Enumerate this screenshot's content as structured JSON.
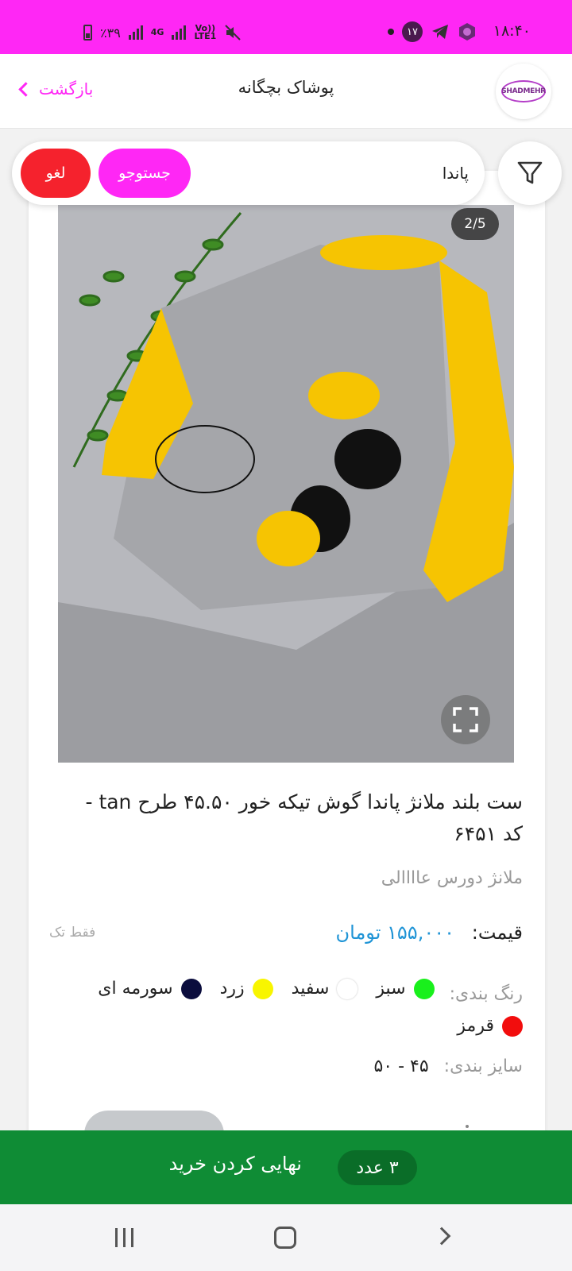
{
  "status_bar": {
    "time": "۱۸:۴۰",
    "notification_count": "۱۷",
    "battery_percent": "٪۳۹",
    "network_4g": "4G",
    "network_volte": "Vo))\nLTE1"
  },
  "header": {
    "back_label": "بازگشت",
    "title": "پوشاک بچگانه",
    "logo_text": "SHADMEHR"
  },
  "search": {
    "value": "پاندا",
    "search_label": "جستوجو",
    "cancel_label": "لغو"
  },
  "image": {
    "counter": "2/5",
    "current": 2,
    "total": 5
  },
  "product": {
    "title": "ست بلند ملانژ پاندا گوش تیکه خور ۴۵.۵۰ طرح tan - کد ۶۴۵۱",
    "fabric": "ملانژ دورس عاااالی",
    "price_label": "قیمت:",
    "price_value": "۱۵۵,۰۰۰ تومان",
    "single_only": "فقط تک",
    "colors_label": "رنگ بندی:",
    "colors": [
      {
        "name": "سبز",
        "hex": "#19f01c"
      },
      {
        "name": "سفید",
        "hex": "#ffffff"
      },
      {
        "name": "زرد",
        "hex": "#f8f500"
      },
      {
        "name": "سورمه ای",
        "hex": "#0b0d3d"
      },
      {
        "name": "قرمز",
        "hex": "#f20d0d"
      }
    ],
    "sizes_label": "سایز بندی:",
    "sizes": "۴۵ - ۵۰"
  },
  "checkout": {
    "count": "۳ عدد",
    "label": "نهایی کردن خرید"
  },
  "colors": {
    "brand_pink": "#ff27f5",
    "cancel_red": "#f5222d",
    "checkout_green": "#0f8c35",
    "price_blue": "#1f94d6"
  }
}
